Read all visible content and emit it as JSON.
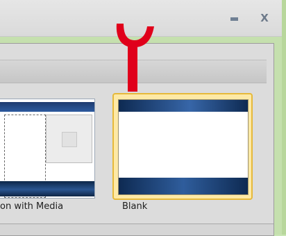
{
  "window": {
    "minimize_label": "",
    "close_label": "X"
  },
  "overlay": {
    "numeral": "٢"
  },
  "layouts": [
    {
      "label": "on with Media"
    },
    {
      "label": "Blank",
      "selected": true
    }
  ],
  "colors": {
    "background": "#c9e6b4",
    "selection_fill": "#fde9a6",
    "selection_border": "#e6b93a",
    "overlay_red": "#e0001b",
    "slide_bar": "#1e3b6f"
  }
}
